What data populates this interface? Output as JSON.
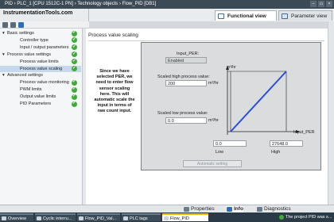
{
  "window": {
    "title": "PID  ›  PLC_1 [CPU 1512C-1 PN]  ›  Technology objects  ›  Flow_PID [DB1]"
  },
  "site": "InstrumentationTools.com",
  "view_tabs": {
    "functional": "Functional view",
    "parameter": "Parameter view"
  },
  "nav": {
    "items": [
      {
        "label": "Basic settings",
        "level": 0,
        "expanded": true,
        "check": true
      },
      {
        "label": "Controller type",
        "level": 1,
        "check": true
      },
      {
        "label": "Input / output parameters",
        "level": 1,
        "check": true
      },
      {
        "label": "Process value settings",
        "level": 0,
        "expanded": true,
        "check": true
      },
      {
        "label": "Process value limits",
        "level": 1,
        "check": true
      },
      {
        "label": "Process value scaling",
        "level": 1,
        "check": true,
        "selected": true
      },
      {
        "label": "Advanced settings",
        "level": 0,
        "expanded": true,
        "check": false
      },
      {
        "label": "Process value monitoring",
        "level": 1,
        "check": true
      },
      {
        "label": "PWM limits",
        "level": 1,
        "check": true
      },
      {
        "label": "Output value limits",
        "level": 1,
        "check": true
      },
      {
        "label": "PID Parameters",
        "level": 1,
        "check": true
      }
    ]
  },
  "content": {
    "section_title": "Process value scaling",
    "note": "Since we have selected PER, we need to enter flow sensor scaling here. This will automatic scale the input in terms of raw count input.",
    "input_per_label": "Input_PER:",
    "input_per_value": "Enabled",
    "scaled_high_label": "Scaled high process value:",
    "scaled_high_value": "200",
    "scaled_high_unit": "m³/hr",
    "scaled_low_label": "Scaled low process value:",
    "scaled_low_value": "0.0",
    "scaled_low_unit": "m³/hr",
    "graph_y_unit": "m³/hr",
    "graph_x_label": "Input_PER",
    "low_value": "0.0",
    "high_value": "27648.0",
    "low_label": "Low",
    "high_label": "High",
    "auto_button": "Automatic setting"
  },
  "bottom_tabs": {
    "properties": "Properties",
    "info": "Info",
    "diagnostics": "Diagnostics"
  },
  "taskbar": {
    "tasks": [
      "Overview",
      "Cyclic interru...",
      "Flow_PID_Val...",
      "PLC tags",
      "Flow_PID"
    ],
    "status": "The project PID was s..."
  },
  "colors": {
    "accent": "#2a6fbf",
    "check": "#3faa34",
    "titlebar": "#3c4a56"
  }
}
